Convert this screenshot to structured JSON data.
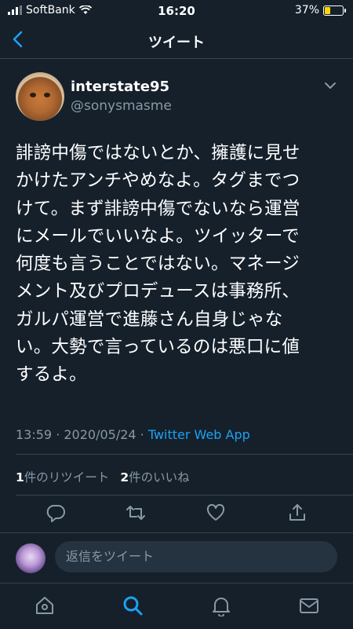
{
  "status_bar": {
    "carrier": "SoftBank",
    "time": "16:20",
    "battery": "37%"
  },
  "nav": {
    "title": "ツイート"
  },
  "tweet": {
    "display_name": "interstate95",
    "handle": "@sonysmasme",
    "lines": [
      "誹謗中傷ではないとか、擁護に見せ",
      "かけたアンチやめなよ。タグまでつ",
      "けて。まず誹謗中傷でないなら運営",
      "にメールでいいなよ。ツイッターで",
      "何度も言うことではない。マネージ",
      "メント及びプロデュースは事務所、",
      "ガルパ運営で進藤さん自身じゃな",
      "い。大勢で言っているのは悪口に値",
      "するよ。"
    ],
    "timestamp": "13:59 · 2020/05/24 · ",
    "source": "Twitter Web App",
    "retweet_count": "1",
    "retweet_label": "件のリツイート",
    "like_count": "2",
    "like_label": "件のいいね"
  },
  "reply": {
    "placeholder": "返信をツイート"
  },
  "icons": [
    "back-arrow-icon",
    "chevron-down-icon",
    "reply-icon",
    "retweet-icon",
    "like-icon",
    "share-icon",
    "home-icon",
    "search-icon",
    "notifications-icon",
    "messages-icon"
  ],
  "colors": {
    "background": "#15202b",
    "accent": "#1da1f2",
    "secondary_text": "#8899a6",
    "divider": "#38444d"
  }
}
